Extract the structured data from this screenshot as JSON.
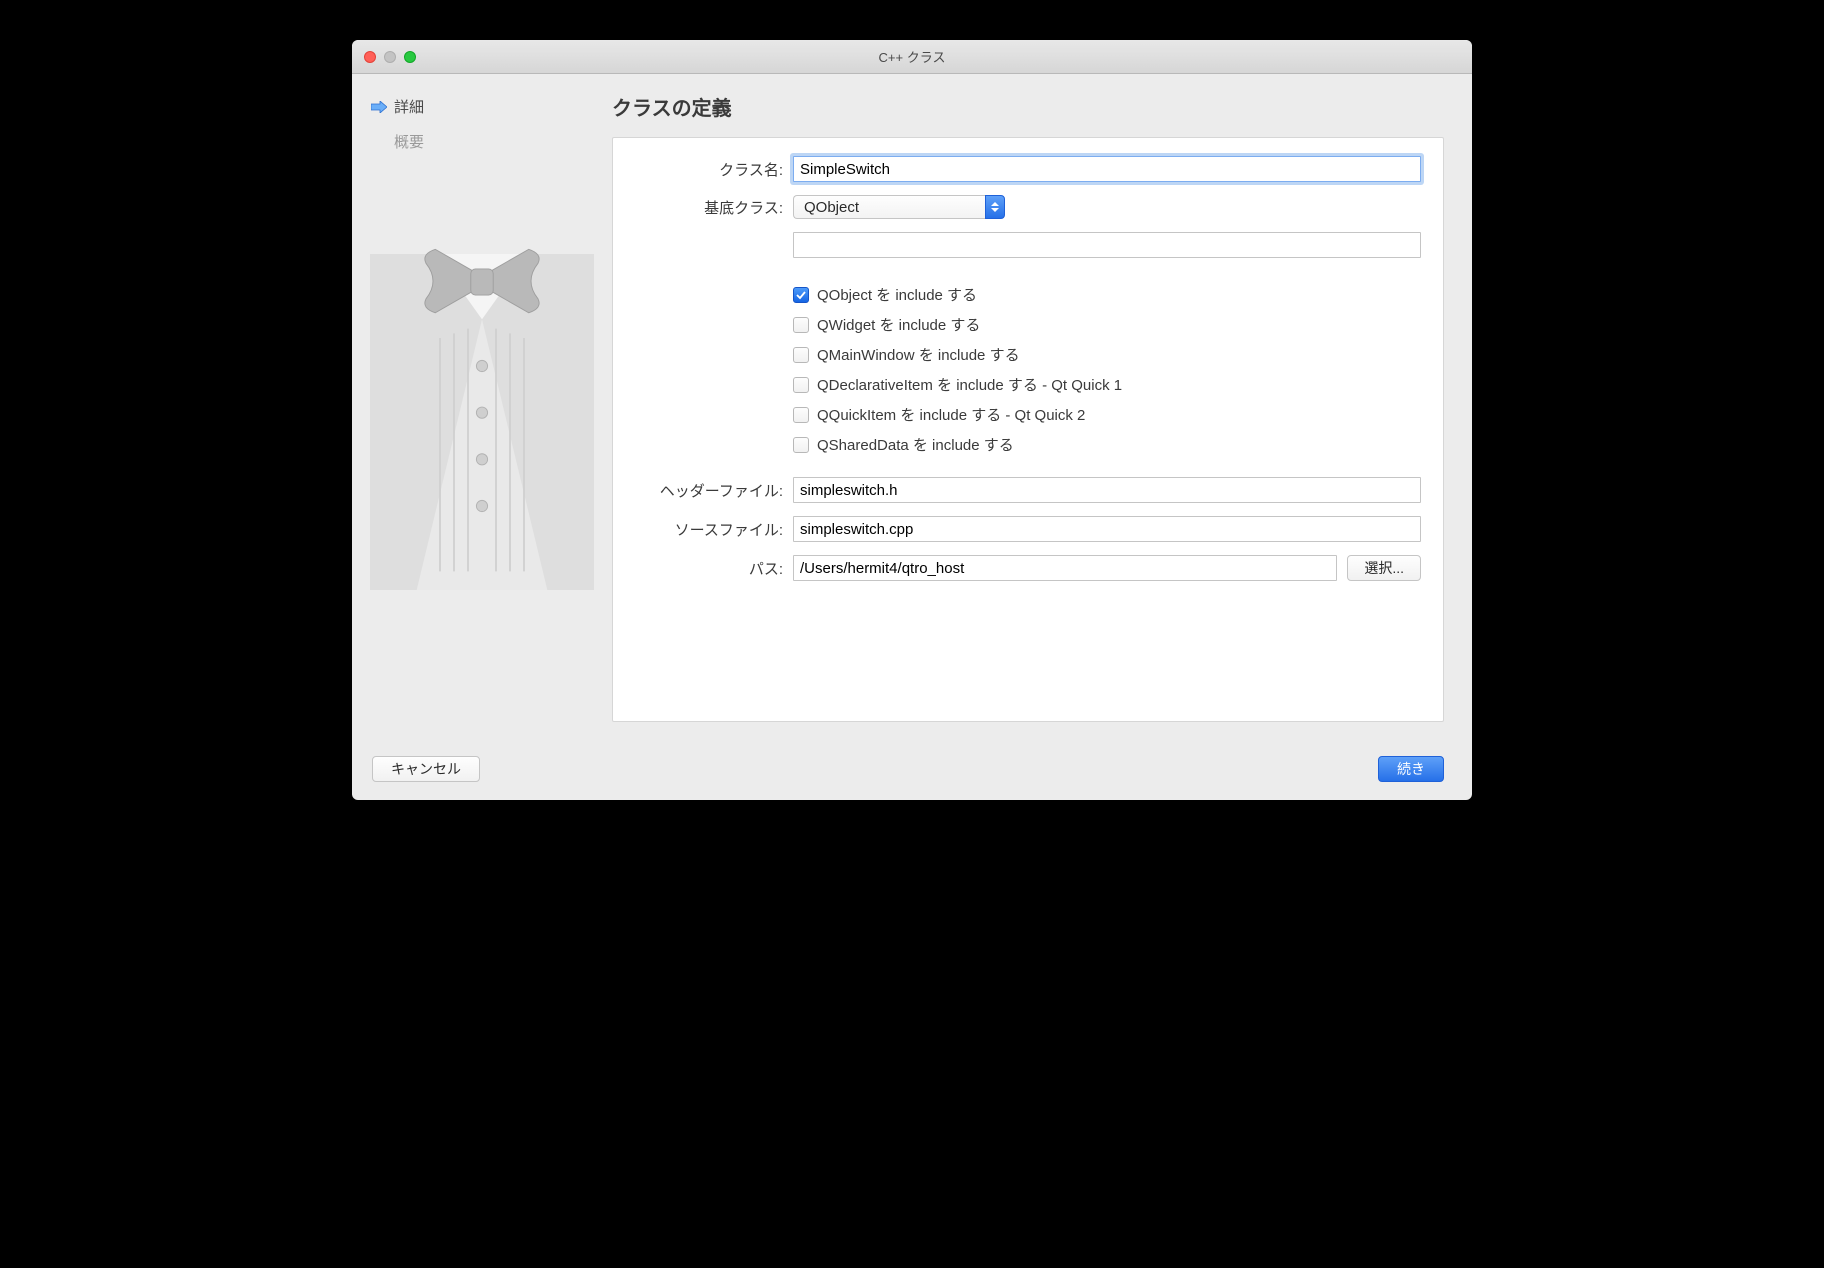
{
  "window": {
    "title": "C++ クラス"
  },
  "sidebar": {
    "steps": [
      {
        "label": "詳細",
        "active": true
      },
      {
        "label": "概要",
        "active": false
      }
    ]
  },
  "main": {
    "heading": "クラスの定義",
    "labels": {
      "class_name": "クラス名:",
      "base_class": "基底クラス:",
      "header_file": "ヘッダーファイル:",
      "source_file": "ソースファイル:",
      "path": "パス:"
    },
    "values": {
      "class_name": "SimpleSwitch",
      "base_class": "QObject",
      "extra": "",
      "header_file": "simpleswitch.h",
      "source_file": "simpleswitch.cpp",
      "path": "/Users/hermit4/qtro_host"
    },
    "checkboxes": [
      {
        "label": "QObject を include する",
        "checked": true
      },
      {
        "label": "QWidget を include する",
        "checked": false
      },
      {
        "label": "QMainWindow を include する",
        "checked": false
      },
      {
        "label": "QDeclarativeItem を include する - Qt Quick 1",
        "checked": false
      },
      {
        "label": "QQuickItem を include する - Qt Quick 2",
        "checked": false
      },
      {
        "label": "QSharedData を include する",
        "checked": false
      }
    ],
    "browse_button": "選択..."
  },
  "footer": {
    "cancel": "キャンセル",
    "continue": "続き"
  }
}
